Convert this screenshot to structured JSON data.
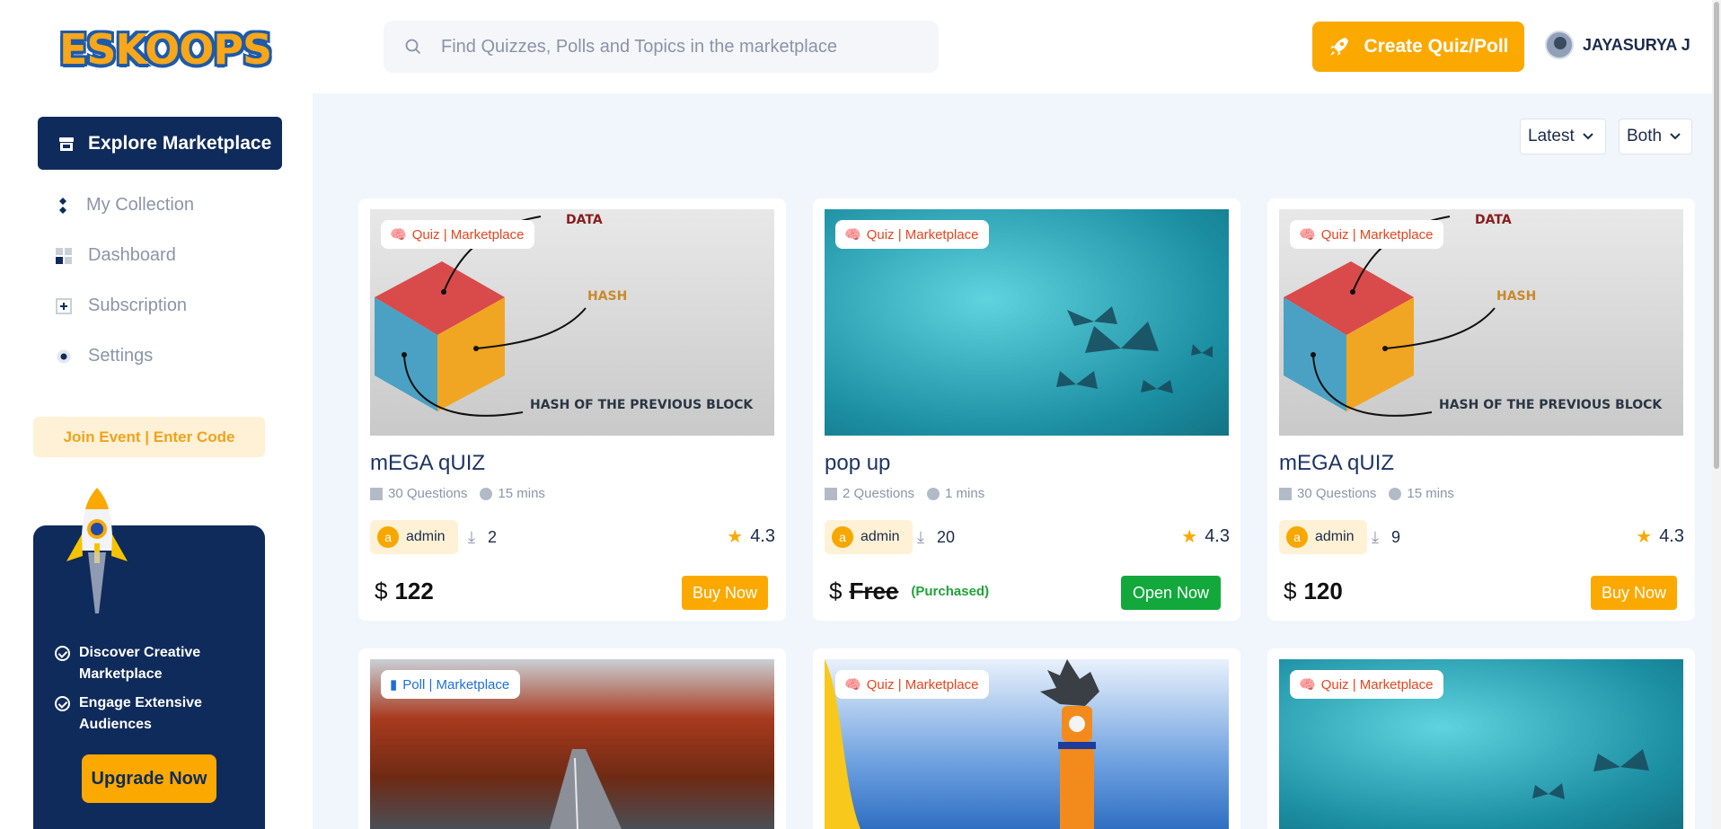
{
  "brand": {
    "logo_text": "ESKOOPS"
  },
  "search": {
    "placeholder": "Find Quizzes, Polls and Topics in the marketplace"
  },
  "header": {
    "create_label": "Create Quiz/Poll",
    "user_name": "JAYASURYA J"
  },
  "sidebar": {
    "active": "Explore Marketplace",
    "items": [
      {
        "label": "My Collection",
        "icon": "collection-icon"
      },
      {
        "label": "Dashboard",
        "icon": "dashboard-icon"
      },
      {
        "label": "Subscription",
        "icon": "subscription-icon"
      },
      {
        "label": "Settings",
        "icon": "settings-icon"
      }
    ],
    "join_label": "Join Event | Enter Code"
  },
  "promo": {
    "items": [
      "Discover Creative Marketplace",
      "Engage Extensive Audiences"
    ],
    "upgrade_label": "Upgrade Now"
  },
  "filters": {
    "sort": "Latest",
    "type": "Both"
  },
  "cards": [
    {
      "badge": "Quiz | Marketplace",
      "title": "mEGA qUIZ",
      "questions": "30 Questions",
      "duration": "15 mins",
      "author": "admin",
      "downloads": "2",
      "rating": "4.3",
      "currency": "$",
      "price": "122",
      "action": "Buy Now",
      "image_labels": {
        "top": "DATA",
        "mid": "HASH",
        "bottom": "HASH OF THE PREVIOUS BLOCK"
      }
    },
    {
      "badge": "Quiz | Marketplace",
      "title": "pop up",
      "questions": "2 Questions",
      "duration": "1 mins",
      "author": "admin",
      "downloads": "20",
      "rating": "4.3",
      "currency": "$",
      "price": "Free",
      "purchased": "(Purchased)",
      "action": "Open Now"
    },
    {
      "badge": "Quiz | Marketplace",
      "title": "mEGA qUIZ",
      "questions": "30 Questions",
      "duration": "15 mins",
      "author": "admin",
      "downloads": "9",
      "rating": "4.3",
      "currency": "$",
      "price": "120",
      "action": "Buy Now",
      "image_labels": {
        "top": "DATA",
        "mid": "HASH",
        "bottom": "HASH OF THE PREVIOUS BLOCK"
      }
    },
    {
      "badge": "Poll | Marketplace"
    },
    {
      "badge": "Quiz | Marketplace"
    },
    {
      "badge": "Quiz | Marketplace"
    }
  ],
  "colors": {
    "brand_navy": "#0f2b5b",
    "accent": "#fba900",
    "quiz_badge": "#e8451e",
    "poll_badge": "#1e6fd9",
    "success": "#12a83c"
  }
}
